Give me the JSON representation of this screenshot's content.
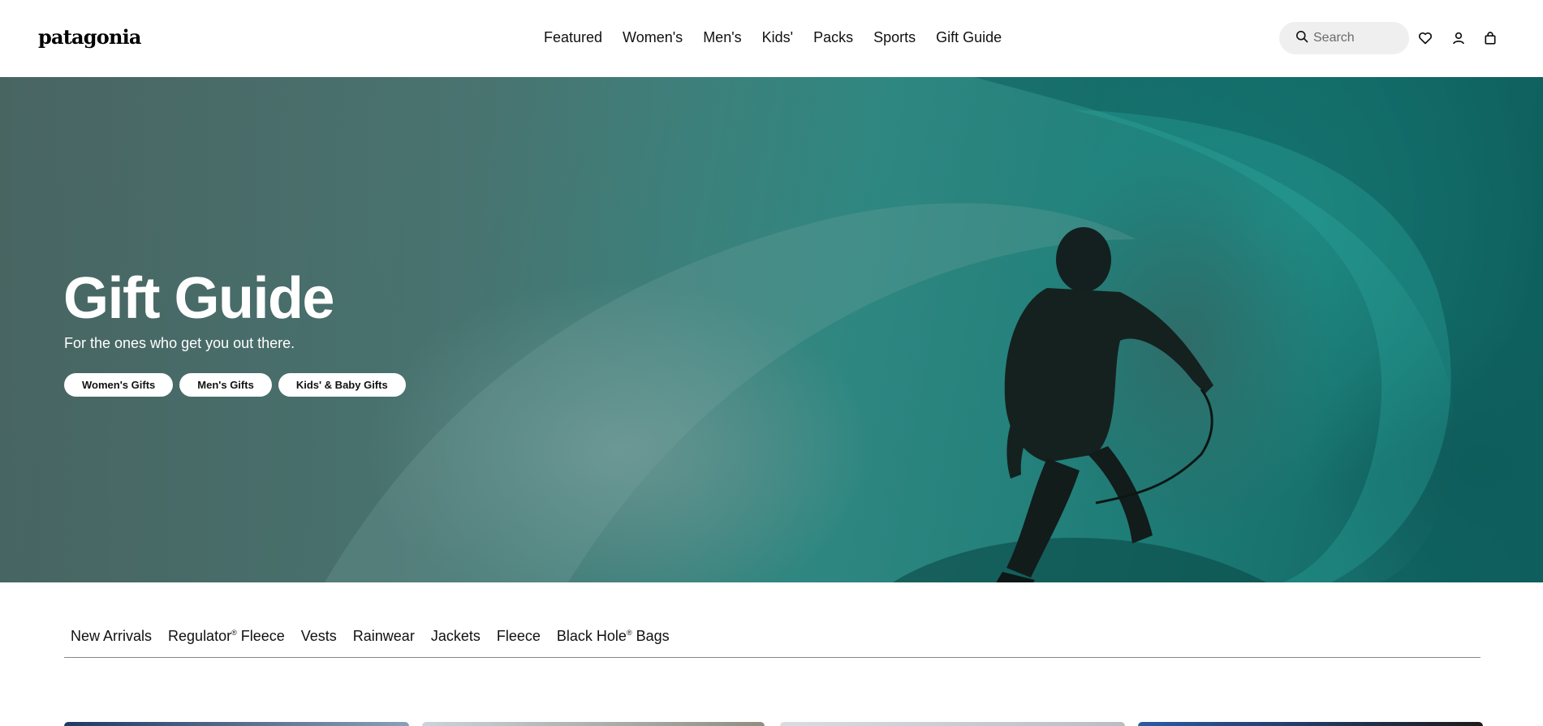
{
  "header": {
    "logo_text": "patagonia",
    "nav": [
      "Featured",
      "Women's",
      "Men's",
      "Kids'",
      "Packs",
      "Sports",
      "Gift Guide"
    ],
    "search_placeholder": "Search",
    "icons": [
      "search-icon",
      "heart-icon",
      "user-icon",
      "bag-icon"
    ]
  },
  "hero": {
    "title": "Gift Guide",
    "subtitle": "For the ones who get you out there.",
    "buttons": [
      "Women's Gifts",
      "Men's Gifts",
      "Kids' & Baby Gifts"
    ]
  },
  "categories": [
    {
      "label": "New Arrivals",
      "suffix": "",
      "mark": ""
    },
    {
      "label": "Regulator",
      "suffix": " Fleece",
      "mark": "®"
    },
    {
      "label": "Vests",
      "suffix": "",
      "mark": ""
    },
    {
      "label": "Rainwear",
      "suffix": "",
      "mark": ""
    },
    {
      "label": "Jackets",
      "suffix": "",
      "mark": ""
    },
    {
      "label": "Fleece",
      "suffix": "",
      "mark": ""
    },
    {
      "label": "Black Hole",
      "suffix": " Bags",
      "mark": "®"
    }
  ],
  "colors": {
    "accent": "#111111",
    "search_bg": "#efefef",
    "hero_teal": "#1f8c85"
  }
}
